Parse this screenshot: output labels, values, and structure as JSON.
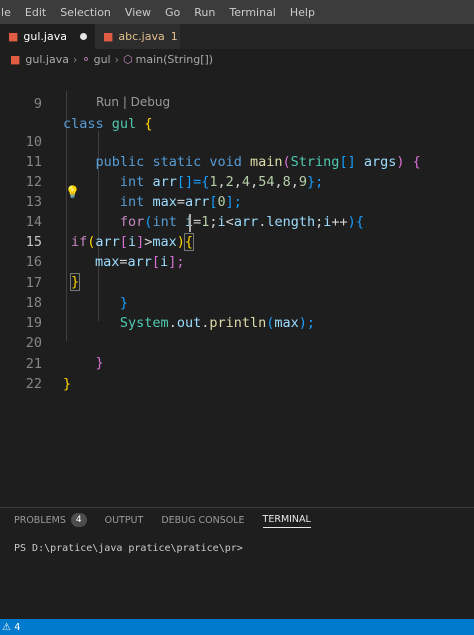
{
  "menu": [
    "ile",
    "Edit",
    "Selection",
    "View",
    "Go",
    "Run",
    "Terminal",
    "Help"
  ],
  "tabs": [
    {
      "label": "gul.java",
      "icon": "java-file-icon",
      "state": "modified"
    },
    {
      "label": "abc.java",
      "icon": "java-file-icon",
      "badge": "1"
    }
  ],
  "breadcrumb": {
    "file": "gul.java",
    "cls": "gul",
    "method": "main(String[])"
  },
  "codelens": "Run | Debug",
  "lines": [
    "9",
    "10",
    "11",
    "12",
    "13",
    "14",
    "15",
    "16",
    "17",
    "18",
    "19",
    "20",
    "21",
    "22"
  ],
  "code": {
    "l9": [
      "class",
      "gul",
      "{"
    ],
    "l10": [
      "public",
      "static",
      "void",
      "main",
      "(",
      "String",
      "[]",
      "args",
      ")",
      "{"
    ],
    "l11": [
      "int",
      "arr",
      "[]",
      "={",
      "1",
      ",",
      "2",
      ",",
      "4",
      ",",
      "54",
      ",",
      "8",
      ",",
      "9",
      "};"
    ],
    "l12": [
      "int",
      "max",
      "=",
      "arr",
      "[",
      "0",
      "];"
    ],
    "l13": [
      "for",
      "(",
      "int",
      "i",
      "=",
      "1",
      ";",
      "i",
      "<",
      "arr",
      ".",
      "length",
      ";",
      "i",
      "++",
      ")",
      "{"
    ],
    "l14": [
      "if",
      "(",
      "arr",
      "[",
      "i",
      "]",
      ">",
      "max",
      ")",
      "{"
    ],
    "l15": [
      "max",
      "=",
      "arr",
      "[",
      "i",
      "];"
    ],
    "l16": [
      "}"
    ],
    "l17": [
      "}"
    ],
    "l18": [
      "System",
      ".",
      "out",
      ".",
      "println",
      "(",
      "max",
      ");"
    ],
    "l20": [
      "}"
    ],
    "l21": [
      "}"
    ]
  },
  "panel": {
    "tabs": [
      "PROBLEMS",
      "OUTPUT",
      "DEBUG CONSOLE",
      "TERMINAL"
    ],
    "problems_count": "4",
    "prompt": "PS D:\\pratice\\java pratice\\pratice\\pr>"
  },
  "status": {
    "warnings": "⚠ 4"
  }
}
